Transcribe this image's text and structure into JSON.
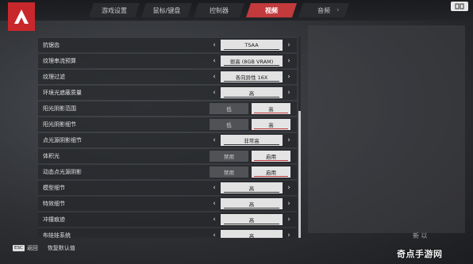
{
  "tabs": [
    "游戏设置",
    "鼠标/键盘",
    "控制器",
    "视频",
    "音频"
  ],
  "active_tab": "视频",
  "settings": [
    {
      "label": "抗锯齿",
      "type": "select",
      "value": "TSAA"
    },
    {
      "label": "纹理串流预算",
      "type": "select",
      "value": "很高 (8GB VRAM)"
    },
    {
      "label": "纹理过滤",
      "type": "select",
      "value": "各向异性 16X"
    },
    {
      "label": "环境光遮蔽质量",
      "type": "select",
      "value": "高"
    },
    {
      "label": "阳光阴影范围",
      "type": "toggle",
      "options": [
        "低",
        "高"
      ],
      "selected": 1
    },
    {
      "label": "阳光阴影细节",
      "type": "toggle",
      "options": [
        "低",
        "高"
      ],
      "selected": 1
    },
    {
      "label": "点光源阴影细节",
      "type": "select",
      "value": "非常高"
    },
    {
      "label": "体积光",
      "type": "toggle",
      "options": [
        "禁用",
        "启用"
      ],
      "selected": 1
    },
    {
      "label": "动态点光源阴影",
      "type": "toggle",
      "options": [
        "禁用",
        "启用"
      ],
      "selected": 1
    },
    {
      "label": "模型细节",
      "type": "select",
      "value": "高"
    },
    {
      "label": "特效细节",
      "type": "select",
      "value": "高"
    },
    {
      "label": "冲撞痕迹",
      "type": "select",
      "value": "高"
    },
    {
      "label": "布娃娃系统",
      "type": "select",
      "value": "高"
    }
  ],
  "bottom": {
    "esc_key": "ESC",
    "back_label": "返回",
    "reset_label": "恢复默认值"
  },
  "corner_text": "新 以",
  "watermark": "奇点手游网",
  "accent_color": "#c23a3c"
}
